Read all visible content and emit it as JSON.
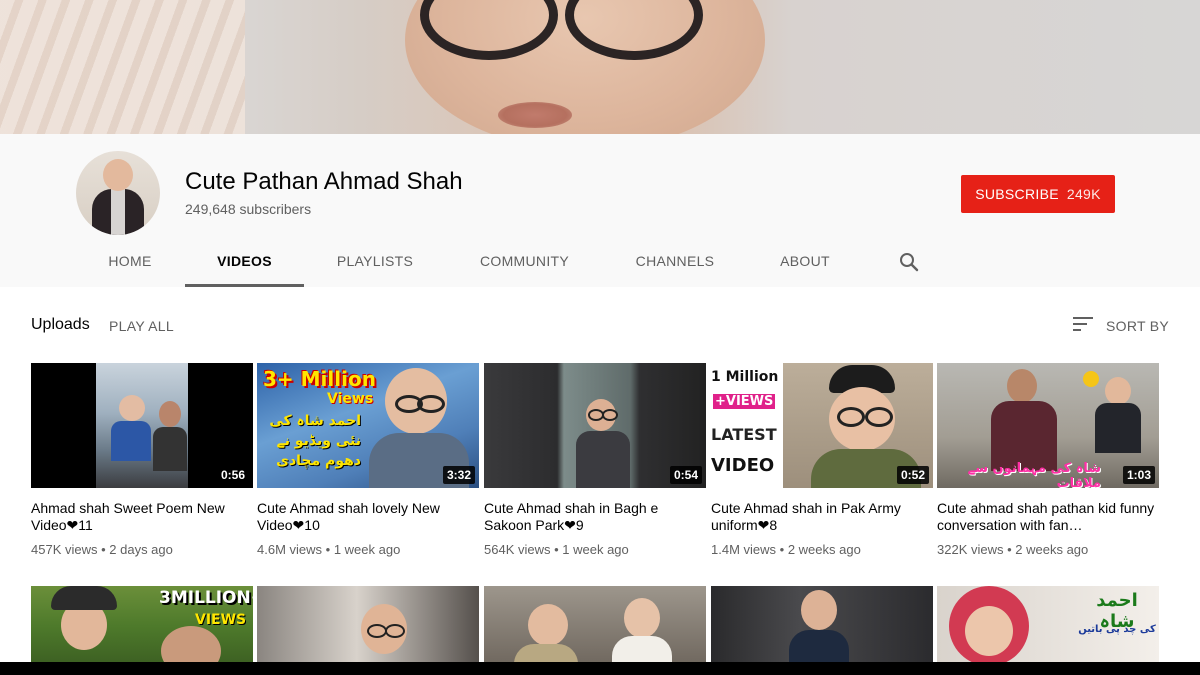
{
  "channel": {
    "name": "Cute Pathan Ahmad Shah",
    "subscribers": "249,648 subscribers",
    "subscribe_label": "SUBSCRIBE",
    "subscribe_count": "249K",
    "subscribe_color": "#e62117"
  },
  "tabs": [
    {
      "label": "HOME"
    },
    {
      "label": "VIDEOS",
      "active": true
    },
    {
      "label": "PLAYLISTS"
    },
    {
      "label": "COMMUNITY"
    },
    {
      "label": "CHANNELS"
    },
    {
      "label": "ABOUT"
    }
  ],
  "tab_search_icon": "search-icon",
  "uploads": {
    "title": "Uploads",
    "play_all": "PLAY ALL",
    "sort_label": "SORT BY",
    "sort_icon": "sort-icon"
  },
  "videos": [
    {
      "title": "Ahmad shah Sweet Poem New Video❤11",
      "views": "457K views",
      "age": "2 days ago",
      "duration": "0:56"
    },
    {
      "title": "Cute Ahmad shah lovely New Video❤10",
      "views": "4.6M views",
      "age": "1 week ago",
      "duration": "3:32",
      "thumb_text": "3+ Million",
      "thumb_text2": "Views",
      "thumb_urdu": "احمد شاہ کی نئی ویڈیو نے دھوم مچادی"
    },
    {
      "title": "Cute Ahmad shah in Bagh e Sakoon Park❤9",
      "views": "564K views",
      "age": "1 week ago",
      "duration": "0:54"
    },
    {
      "title": "Cute Ahmad shah in Pak Army uniform❤8",
      "views": "1.4M views",
      "age": "2 weeks ago",
      "duration": "0:52",
      "thumb_text": "1 Million",
      "thumb_text2": "+VIEWS",
      "thumb_text3": "LATEST",
      "thumb_text4": "VIDEO"
    },
    {
      "title": "Cute ahmad shah pathan kid funny conversation with fan…",
      "views": "322K views",
      "age": "2 weeks ago",
      "duration": "1:03",
      "thumb_urdu": "شاہ کی مہمانوں سے ملاقات"
    }
  ],
  "videos_row2": [
    {
      "thumb_text": "3MILLION+",
      "thumb_text2": "VIEWS"
    },
    {},
    {},
    {},
    {
      "thumb_urdu": "احمد شاہ",
      "thumb_urdu2": "کی چد پی باتیں"
    }
  ]
}
